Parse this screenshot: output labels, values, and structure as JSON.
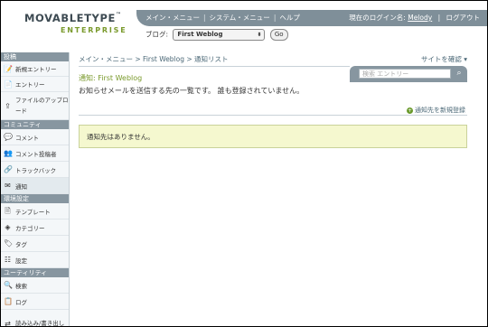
{
  "header": {
    "logo_main": "MOVABLETYPE",
    "logo_tm": "™",
    "logo_sub": "ENTERPRISE",
    "nav": [
      "メイン・メニュー",
      "システム・メニュー",
      "ヘルプ"
    ],
    "nav_sep": "|",
    "user_prefix": "現在のログイン名:",
    "user_name": "Melody",
    "logout": "ログアウト",
    "blog_label": "ブログ:",
    "blog_selected": "First Weblog",
    "go_label": "Go"
  },
  "sidebar": {
    "sections": [
      {
        "title": "投稿",
        "items": [
          {
            "label": "新規エントリー",
            "icon": "new-entry-icon"
          },
          {
            "label": "エントリー",
            "icon": "entries-icon"
          },
          {
            "label": "ファイルのアップロード",
            "icon": "upload-icon"
          }
        ]
      },
      {
        "title": "コミュニティ",
        "items": [
          {
            "label": "コメント",
            "icon": "comment-icon"
          },
          {
            "label": "コメント投稿者",
            "icon": "commenter-icon"
          },
          {
            "label": "トラックバック",
            "icon": "trackback-icon"
          },
          {
            "label": "通知",
            "icon": "notification-icon"
          }
        ]
      },
      {
        "title": "環境設定",
        "items": [
          {
            "label": "テンプレート",
            "icon": "template-icon"
          },
          {
            "label": "カテゴリー",
            "icon": "category-icon"
          },
          {
            "label": "タグ",
            "icon": "tag-icon"
          },
          {
            "label": "設定",
            "icon": "settings-icon"
          }
        ]
      },
      {
        "title": "ユーティリティ",
        "items": [
          {
            "label": "検索",
            "icon": "search-icon"
          },
          {
            "label": "ログ",
            "icon": "log-icon"
          },
          {
            "label": "読み込み/書き出し",
            "icon": "import-export-icon"
          }
        ]
      }
    ]
  },
  "main": {
    "breadcrumb": "メイン・メニュー > First Weblog > 通知リスト",
    "site_confirm": "サイトを確認 ▾",
    "title": "通知: First Weblog",
    "description": "お知らせメールを送信する先の一覧です。 誰も登録されていません。",
    "search_placeholder": "検索 エントリー",
    "add_link": "通知先を新規登録",
    "empty_message": "通知先はありません。"
  },
  "colors": {
    "accent_green": "#7a9a2c",
    "nav_gray": "#7f8f99",
    "notice_bg": "#f5f8cf"
  }
}
